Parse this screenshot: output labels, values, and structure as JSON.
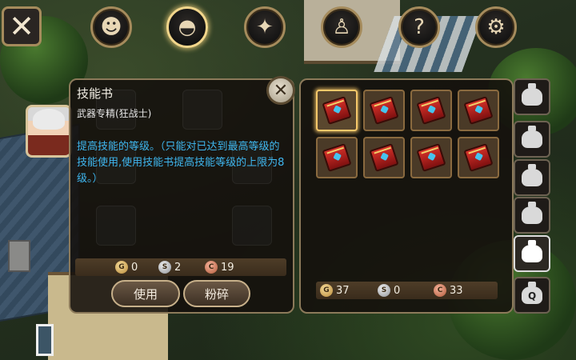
{
  "top_bar": {
    "close_label": "✕",
    "buttons": [
      {
        "name": "character-profile",
        "icon": "head-silhouette-icon",
        "glyph": "☻"
      },
      {
        "name": "inventory-bag",
        "icon": "bag-icon",
        "glyph": "◓"
      },
      {
        "name": "skills",
        "icon": "sword-star-icon",
        "glyph": "✦"
      },
      {
        "name": "party",
        "icon": "group-icon",
        "glyph": "♙"
      },
      {
        "name": "quests",
        "icon": "scroll-question-icon",
        "glyph": "?"
      },
      {
        "name": "settings",
        "icon": "gear-icon",
        "glyph": "⚙"
      }
    ],
    "active_index": 1
  },
  "item_info": {
    "title": "技能书",
    "subtitle": "武器专精(狂战士)",
    "description": "提高技能的等级。（只能对已达到最高等级的技能使用,使用技能书提高技能等级的上限为8级。）",
    "close_label": "✕",
    "price": {
      "gold": "0",
      "silver": "2",
      "copper": "19"
    },
    "use_label": "使用",
    "smash_label": "粉碎"
  },
  "inventory": {
    "slots": [
      {
        "item": "skill-book",
        "selected": true
      },
      {
        "item": "skill-book",
        "selected": false
      },
      {
        "item": "skill-book",
        "selected": false
      },
      {
        "item": "skill-book",
        "selected": false
      },
      {
        "item": "skill-book",
        "selected": false
      },
      {
        "item": "skill-book",
        "selected": false
      },
      {
        "item": "skill-book",
        "selected": false
      },
      {
        "item": "skill-book",
        "selected": false
      }
    ],
    "money": {
      "gold": "37",
      "silver": "0",
      "copper": "33"
    }
  },
  "bag_tabs": [
    {
      "name": "bag-1",
      "active": false
    },
    {
      "name": "bag-2",
      "active": false
    },
    {
      "name": "bag-3",
      "active": false
    },
    {
      "name": "bag-4",
      "active": false
    },
    {
      "name": "bag-5",
      "active": true
    },
    {
      "name": "quest-bag",
      "active": false,
      "label": "Q"
    }
  ],
  "colors": {
    "frame": "#8c7a5a",
    "description_text": "#3fb7f0",
    "selected_slot": "#f6c86a"
  }
}
